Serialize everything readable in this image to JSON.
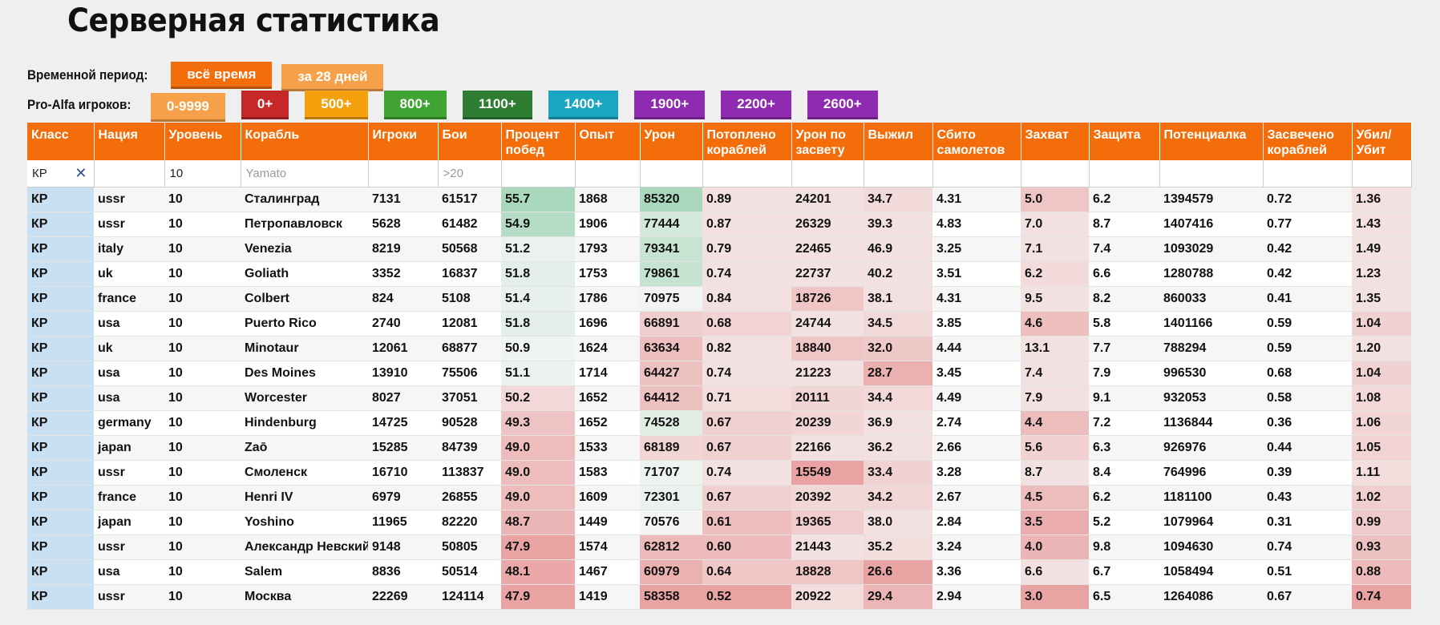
{
  "title": "Серверная статистика",
  "period": {
    "label": "Временной период:",
    "buttons": [
      "всё время",
      "за 28 дней"
    ]
  },
  "players": {
    "label": "Pro-Alfa игроков:",
    "buttons": [
      "0-9999",
      "0+",
      "500+",
      "800+",
      "1100+",
      "1400+",
      "1900+",
      "2200+",
      "2600+"
    ]
  },
  "columns": [
    "Класс",
    "Нация",
    "Уровень",
    "Корабль",
    "Игроки",
    "Бои",
    "Процент побед",
    "Опыт",
    "Урон",
    "Потоплено кораблей",
    "Урон по засвету",
    "Выжил",
    "Сбито самолетов",
    "Захват",
    "Защита",
    "Потенциалка",
    "Засвечено кораблей",
    "Убил/ Убит"
  ],
  "filters": {
    "class_value": "КР",
    "clear_icon": "close-icon",
    "tier_value": "10",
    "ship_placeholder": "Yamato",
    "battles_placeholder": ">20"
  },
  "rows": [
    [
      "КР",
      "ussr",
      "10",
      "Сталинград",
      "7131",
      "61517",
      "55.7",
      "1868",
      "85320",
      "0.89",
      "24201",
      "34.7",
      "4.31",
      "5.0",
      "6.2",
      "1394579",
      "0.72",
      "1.36"
    ],
    [
      "КР",
      "ussr",
      "10",
      "Петропавловск",
      "5628",
      "61482",
      "54.9",
      "1906",
      "77444",
      "0.87",
      "26329",
      "39.3",
      "4.83",
      "7.0",
      "8.7",
      "1407416",
      "0.77",
      "1.43"
    ],
    [
      "КР",
      "italy",
      "10",
      "Venezia",
      "8219",
      "50568",
      "51.2",
      "1793",
      "79341",
      "0.79",
      "22465",
      "46.9",
      "3.25",
      "7.1",
      "7.4",
      "1093029",
      "0.42",
      "1.49"
    ],
    [
      "КР",
      "uk",
      "10",
      "Goliath",
      "3352",
      "16837",
      "51.8",
      "1753",
      "79861",
      "0.74",
      "22737",
      "40.2",
      "3.51",
      "6.2",
      "6.6",
      "1280788",
      "0.42",
      "1.23"
    ],
    [
      "КР",
      "france",
      "10",
      "Colbert",
      "824",
      "5108",
      "51.4",
      "1786",
      "70975",
      "0.84",
      "18726",
      "38.1",
      "4.31",
      "9.5",
      "8.2",
      "860033",
      "0.41",
      "1.35"
    ],
    [
      "КР",
      "usa",
      "10",
      "Puerto Rico",
      "2740",
      "12081",
      "51.8",
      "1696",
      "66891",
      "0.68",
      "24744",
      "34.5",
      "3.85",
      "4.6",
      "5.8",
      "1401166",
      "0.59",
      "1.04"
    ],
    [
      "КР",
      "uk",
      "10",
      "Minotaur",
      "12061",
      "68877",
      "50.9",
      "1624",
      "63634",
      "0.82",
      "18840",
      "32.0",
      "4.44",
      "13.1",
      "7.7",
      "788294",
      "0.59",
      "1.20"
    ],
    [
      "КР",
      "usa",
      "10",
      "Des Moines",
      "13910",
      "75506",
      "51.1",
      "1714",
      "64427",
      "0.74",
      "21223",
      "28.7",
      "3.45",
      "7.4",
      "7.9",
      "996530",
      "0.68",
      "1.04"
    ],
    [
      "КР",
      "usa",
      "10",
      "Worcester",
      "8027",
      "37051",
      "50.2",
      "1652",
      "64412",
      "0.71",
      "20111",
      "34.4",
      "4.49",
      "7.9",
      "9.1",
      "932053",
      "0.58",
      "1.08"
    ],
    [
      "КР",
      "germany",
      "10",
      "Hindenburg",
      "14725",
      "90528",
      "49.3",
      "1652",
      "74528",
      "0.67",
      "20239",
      "36.9",
      "2.74",
      "4.4",
      "7.2",
      "1136844",
      "0.36",
      "1.06"
    ],
    [
      "КР",
      "japan",
      "10",
      "Zaō",
      "15285",
      "84739",
      "49.0",
      "1533",
      "68189",
      "0.67",
      "22166",
      "36.2",
      "2.66",
      "5.6",
      "6.3",
      "926976",
      "0.44",
      "1.05"
    ],
    [
      "КР",
      "ussr",
      "10",
      "Смоленск",
      "16710",
      "113837",
      "49.0",
      "1583",
      "71707",
      "0.74",
      "15549",
      "33.4",
      "3.28",
      "8.7",
      "8.4",
      "764996",
      "0.39",
      "1.11"
    ],
    [
      "КР",
      "france",
      "10",
      "Henri IV",
      "6979",
      "26855",
      "49.0",
      "1609",
      "72301",
      "0.67",
      "20392",
      "34.2",
      "2.67",
      "4.5",
      "6.2",
      "1181100",
      "0.43",
      "1.02"
    ],
    [
      "КР",
      "japan",
      "10",
      "Yoshino",
      "11965",
      "82220",
      "48.7",
      "1449",
      "70576",
      "0.61",
      "19365",
      "38.0",
      "2.84",
      "3.5",
      "5.2",
      "1079964",
      "0.31",
      "0.99"
    ],
    [
      "КР",
      "ussr",
      "10",
      "Александр Невский",
      "9148",
      "50805",
      "47.9",
      "1574",
      "62812",
      "0.60",
      "21443",
      "35.2",
      "3.24",
      "4.0",
      "9.8",
      "1094630",
      "0.74",
      "0.93"
    ],
    [
      "КР",
      "usa",
      "10",
      "Salem",
      "8836",
      "50514",
      "48.1",
      "1467",
      "60979",
      "0.64",
      "18828",
      "26.6",
      "3.36",
      "6.6",
      "6.7",
      "1058494",
      "0.51",
      "0.88"
    ],
    [
      "КР",
      "ussr",
      "10",
      "Москва",
      "22269",
      "124114",
      "47.9",
      "1419",
      "58358",
      "0.52",
      "20922",
      "29.4",
      "2.94",
      "3.0",
      "6.5",
      "1264086",
      "0.67",
      "0.74"
    ]
  ],
  "colors": {
    "header_orange": "#f36d0b",
    "good_green": "#a9d8bd",
    "bad_red": "#e9a3a3",
    "class_blue": "#c9dff2"
  }
}
